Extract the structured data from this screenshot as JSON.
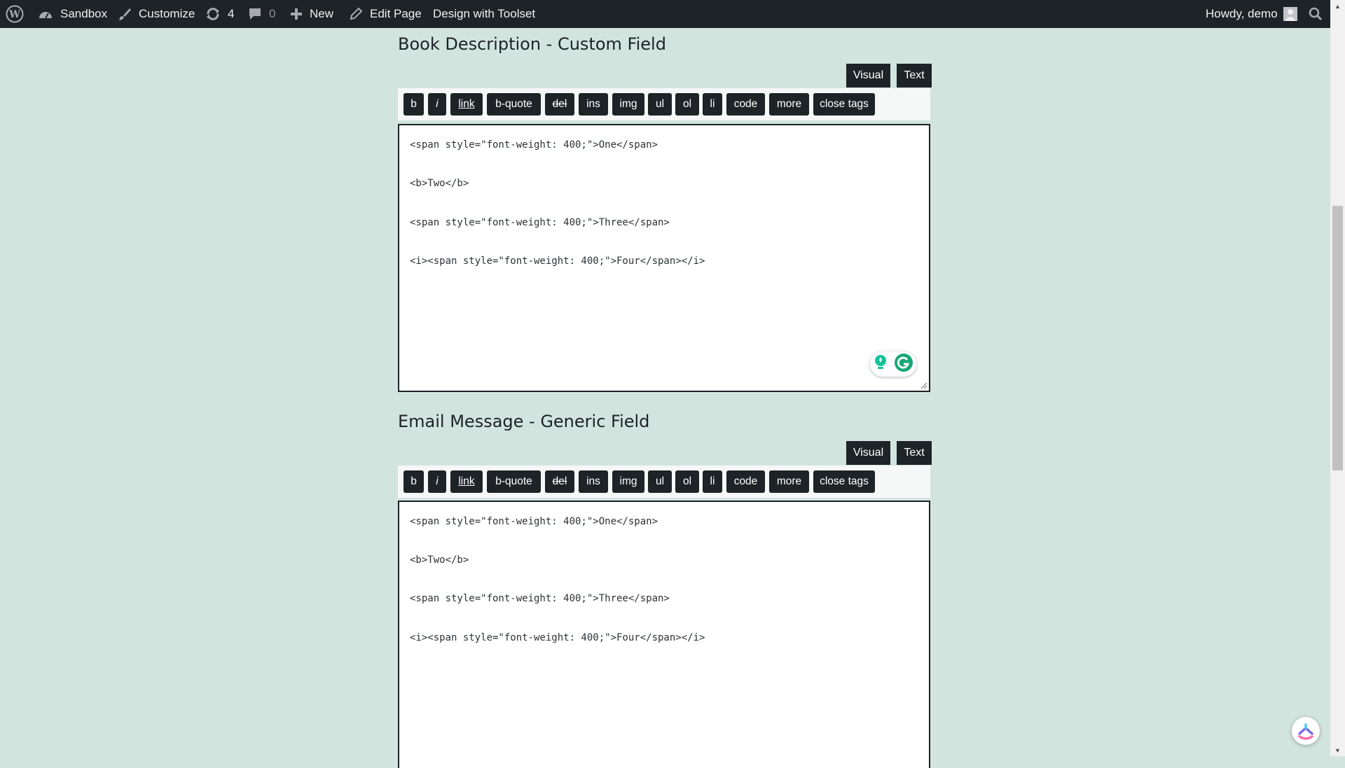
{
  "adminbar": {
    "site_name": "Sandbox",
    "customize": "Customize",
    "updates_count": "4",
    "comments_count": "0",
    "new_label": "New",
    "edit_page": "Edit Page",
    "toolset": "Design with Toolset",
    "howdy": "Howdy, demo",
    "icons": [
      "wordpress-logo-icon",
      "dashboard-icon",
      "brush-icon",
      "updates-icon",
      "comment-icon",
      "plus-icon",
      "pencil-icon",
      "avatar",
      "search-icon"
    ]
  },
  "editors": [
    {
      "title": "Book Description - Custom Field",
      "tabs": {
        "visual": "Visual",
        "text": "Text"
      },
      "lines": [
        "<span style=\"font-weight: 400;\">One</span>",
        "<b>Two</b>",
        "<span style=\"font-weight: 400;\">Three</span>",
        "<i><span style=\"font-weight: 400;\">Four</span></i>"
      ]
    },
    {
      "title": "Email Message - Generic Field",
      "tabs": {
        "visual": "Visual",
        "text": "Text"
      },
      "lines": [
        "<span style=\"font-weight: 400;\">One</span>",
        "<b>Two</b>",
        "<span style=\"font-weight: 400;\">Three</span>",
        "<i><span style=\"font-weight: 400;\">Four</span></i>"
      ]
    }
  ],
  "quicktags": [
    "b",
    "i",
    "link",
    "b-quote",
    "del",
    "ins",
    "img",
    "ul",
    "ol",
    "li",
    "code",
    "more",
    "close tags"
  ],
  "colors": {
    "adminbar_bg": "#1d2327",
    "page_bg": "#d2e4de",
    "button_bg": "#1d2327"
  }
}
